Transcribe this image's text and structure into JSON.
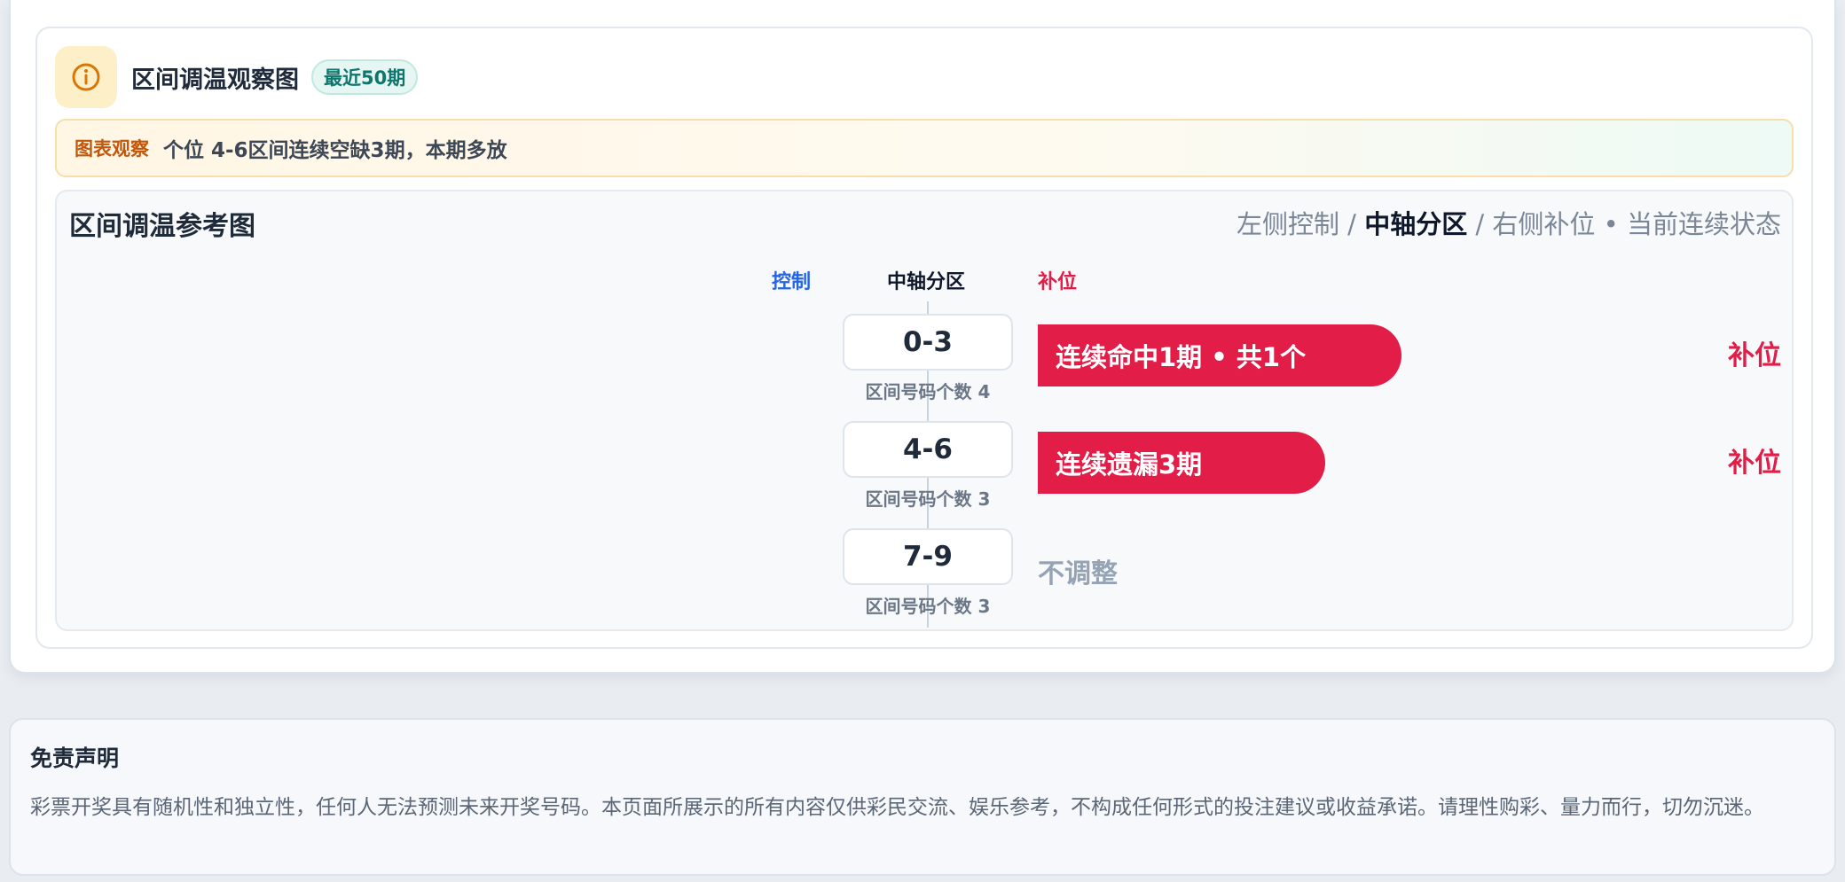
{
  "header": {
    "icon": "info-icon",
    "title": "区间调温观察图",
    "period_badge": "最近50期"
  },
  "observation": {
    "label": "图表观察",
    "text": "个位 4-6区间连续空缺3期，本期多放"
  },
  "panel": {
    "title": "区间调温参考图",
    "legend": {
      "left": "左侧控制",
      "sep1": " / ",
      "center": "中轴分区",
      "sep2": " / ",
      "right": "右侧补位",
      "dot": " • ",
      "state": "当前连续状态"
    },
    "columns": {
      "control": "控制",
      "axis": "中轴分区",
      "fill": "补位"
    },
    "zones": [
      {
        "range": "0-3",
        "count_label": "区间号码个数 4",
        "bar_text": "连续命中1期 • 共1个",
        "side_tag": "补位"
      },
      {
        "range": "4-6",
        "count_label": "区间号码个数 3",
        "bar_text": "连续遗漏3期",
        "side_tag": "补位"
      },
      {
        "range": "7-9",
        "count_label": "区间号码个数 3",
        "status_text": "不调整"
      }
    ]
  },
  "disclaimer": {
    "title": "免责声明",
    "text": "彩票开奖具有随机性和独立性，任何人无法预测未来开奖号码。本页面所展示的所有内容仅供彩民交流、娱乐参考，不构成任何形式的投注建议或收益承诺。请理性购彩、量力而行，切勿沉迷。"
  },
  "colors": {
    "accent_fill": "#e11d48",
    "accent_control": "#2563eb",
    "badge_green": "#0f766e",
    "observe_orange": "#c2570c"
  }
}
